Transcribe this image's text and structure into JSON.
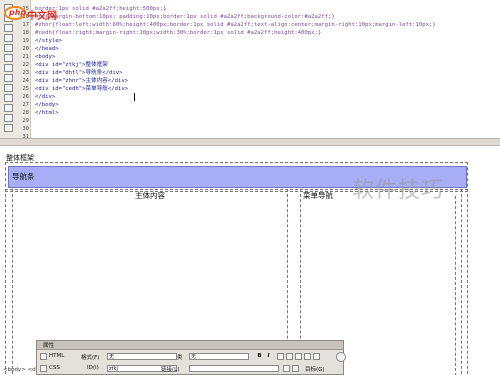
{
  "code_view": {
    "line_numbers": [
      "15",
      "16",
      "17",
      "18",
      "19",
      "20",
      "21",
      "22",
      "23",
      "24",
      "25",
      "26",
      "27",
      "28",
      "29",
      "30",
      "31",
      "32",
      "33"
    ],
    "lines": [
      {
        "text": "border:1px solid #a2a2ff;height:500px;}",
        "kind": "style"
      },
      {
        "text": "#nv{ margin-bottom:10px; padding:10px;border:1px solid #a2a2ff;background-color:#a2a2ff;}",
        "kind": "style"
      },
      {
        "text": "#zhnr{float:left;width:60%;height:400px;border:1px solid #a2a2ff;text-align:center;margin-right:10px;margin-left:10px;}",
        "kind": "style"
      },
      {
        "text": "#cedh{float:right;margin-right:10px;width:30%;border:1px solid #a2a2ff;height:400px;}",
        "kind": "style"
      },
      {
        "text": "</style>",
        "kind": "tag"
      },
      {
        "text": "</head>",
        "kind": "tag"
      },
      {
        "text": "<body>",
        "kind": "tag"
      },
      {
        "text": "<div id=\"ztkj\">整体框架",
        "kind": "tag"
      },
      {
        "text": "<div id=\"dhtl\">导航条</div>",
        "kind": "tag"
      },
      {
        "text": "<div id=\"zhnr\">主体内容</div>",
        "kind": "tag"
      },
      {
        "text": "<div id=\"cedh\">菜单导航</div>",
        "kind": "tag"
      },
      {
        "text": "</div>",
        "kind": "tag"
      },
      {
        "text": "</body>",
        "kind": "tag"
      },
      {
        "text": "</html>",
        "kind": "tag"
      },
      {
        "text": "",
        "kind": "tag"
      }
    ]
  },
  "design_view": {
    "frame_label": "整体框架",
    "nav_label": "导航条",
    "main_label": "主体内容",
    "side_label": "菜单导航"
  },
  "status_bar": {
    "tag_path": "<body> <div#ztkj>"
  },
  "properties_panel": {
    "title": "属性",
    "html_tab": "HTML",
    "css_tab": "CSS",
    "format_label": "格式(F)",
    "format_value": "无",
    "class_label": "类",
    "class_value": "无",
    "id_label": "ID(I)",
    "id_value": "ztkj",
    "link_label": "链接(L)",
    "link_value": "",
    "target_label": "目标(G)",
    "bold_label": "B",
    "italic_label": "I"
  },
  "logo": {
    "mark": "php",
    "text": "中文网"
  },
  "watermark": "软件技巧",
  "colors": {
    "nav_fill": "#a8aef6",
    "nav_border": "#6e74c8",
    "logo_red": "#e0301e",
    "logo_orange": "#f28a1a"
  }
}
